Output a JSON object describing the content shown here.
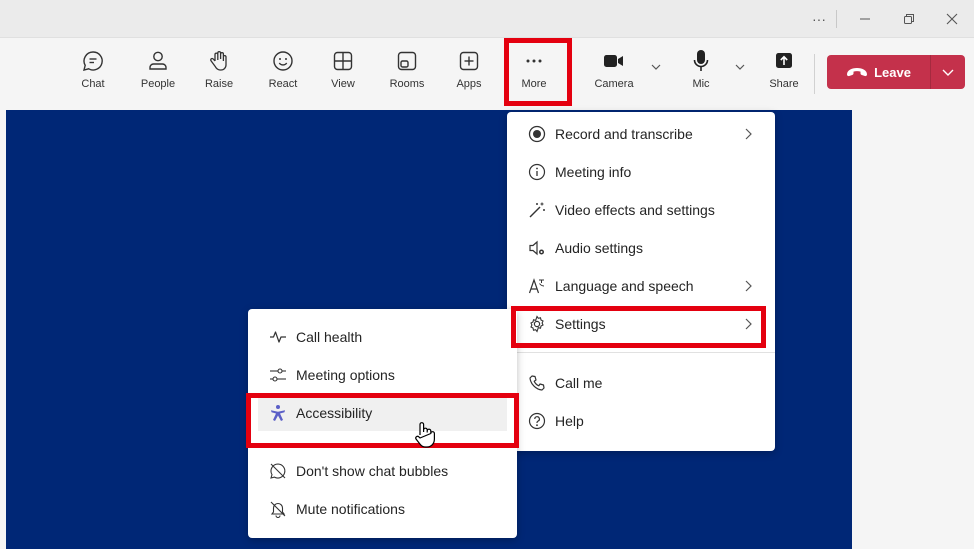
{
  "titlebar": {
    "more_label": "···",
    "minimize_label": "—",
    "restore_label": "▢",
    "close_label": "✕"
  },
  "toolbar": {
    "chat": "Chat",
    "people": "People",
    "raise": "Raise",
    "react": "React",
    "view": "View",
    "rooms": "Rooms",
    "apps": "Apps",
    "more": "More",
    "camera": "Camera",
    "mic": "Mic",
    "share": "Share",
    "leave": "Leave"
  },
  "more_menu": {
    "items": [
      {
        "label": "Record and transcribe",
        "icon": "record-icon"
      },
      {
        "label": "Meeting info",
        "icon": "info-icon"
      },
      {
        "label": "Video effects and settings",
        "icon": "magic-wand-icon"
      },
      {
        "label": "Audio settings",
        "icon": "speaker-gear-icon"
      },
      {
        "label": "Language and speech",
        "icon": "translate-icon"
      },
      {
        "label": "Settings",
        "icon": "gear-icon"
      },
      {
        "label": "Call me",
        "icon": "phone-icon"
      },
      {
        "label": "Help",
        "icon": "help-icon"
      }
    ]
  },
  "settings_menu": {
    "items": [
      {
        "label": "Call health",
        "icon": "pulse-icon"
      },
      {
        "label": "Meeting options",
        "icon": "sliders-icon"
      },
      {
        "label": "Accessibility",
        "icon": "accessibility-icon"
      },
      {
        "label": "Don't show chat bubbles",
        "icon": "chat-off-icon"
      },
      {
        "label": "Mute notifications",
        "icon": "bell-off-icon"
      }
    ]
  },
  "colors": {
    "stage": "#002776",
    "leave": "#c4314b",
    "highlight": "#e4000f",
    "accessibility_icon": "#5b5fc7"
  }
}
